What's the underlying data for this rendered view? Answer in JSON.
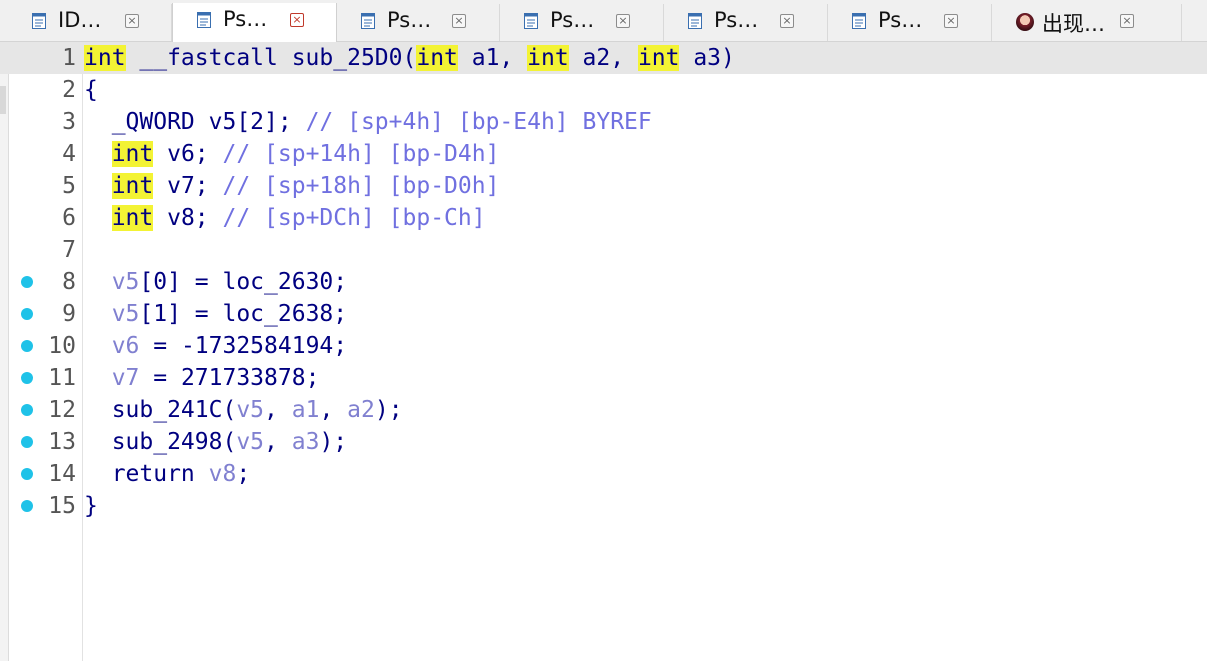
{
  "tabs": [
    {
      "label": "ID…",
      "icon": "document-icon",
      "active": false
    },
    {
      "label": "Ps…",
      "icon": "document-icon",
      "active": true
    },
    {
      "label": "Ps…",
      "icon": "document-icon",
      "active": false
    },
    {
      "label": "Ps…",
      "icon": "document-icon",
      "active": false
    },
    {
      "label": "Ps…",
      "icon": "document-icon",
      "active": false
    },
    {
      "label": "Ps…",
      "icon": "document-icon",
      "active": false
    },
    {
      "label": "出现…",
      "icon": "avatar-icon",
      "active": false
    }
  ],
  "close_glyph": "×",
  "colors": {
    "keyword_highlight": "#f3f334",
    "breakpoint": "#1fc2e8",
    "code_text": "#000080",
    "variable": "#8080d0",
    "comment": "#7070e0",
    "current_line": "#e6e6e6"
  },
  "code": {
    "lines": [
      {
        "num": "1",
        "bp": false,
        "current": true,
        "tokens": [
          {
            "t": "int",
            "c": "kw"
          },
          {
            "t": " __fastcall sub_25D0(",
            "c": "plain"
          },
          {
            "t": "int",
            "c": "kw"
          },
          {
            "t": " a1, ",
            "c": "plain"
          },
          {
            "t": "int",
            "c": "kw"
          },
          {
            "t": " a2, ",
            "c": "plain"
          },
          {
            "t": "int",
            "c": "kw"
          },
          {
            "t": " a3)",
            "c": "plain"
          }
        ]
      },
      {
        "num": "2",
        "bp": false,
        "current": false,
        "tokens": [
          {
            "t": "{",
            "c": "plain"
          }
        ]
      },
      {
        "num": "3",
        "bp": false,
        "current": false,
        "tokens": [
          {
            "t": "  _QWORD v5[2]; ",
            "c": "plain"
          },
          {
            "t": "// [sp+4h] [bp-E4h] BYREF",
            "c": "cm"
          }
        ]
      },
      {
        "num": "4",
        "bp": false,
        "current": false,
        "tokens": [
          {
            "t": "  ",
            "c": "plain"
          },
          {
            "t": "int",
            "c": "kw"
          },
          {
            "t": " v6; ",
            "c": "plain"
          },
          {
            "t": "// [sp+14h] [bp-D4h]",
            "c": "cm"
          }
        ]
      },
      {
        "num": "5",
        "bp": false,
        "current": false,
        "tokens": [
          {
            "t": "  ",
            "c": "plain"
          },
          {
            "t": "int",
            "c": "kw"
          },
          {
            "t": " v7; ",
            "c": "plain"
          },
          {
            "t": "// [sp+18h] [bp-D0h]",
            "c": "cm"
          }
        ]
      },
      {
        "num": "6",
        "bp": false,
        "current": false,
        "tokens": [
          {
            "t": "  ",
            "c": "plain"
          },
          {
            "t": "int",
            "c": "kw"
          },
          {
            "t": " v8; ",
            "c": "plain"
          },
          {
            "t": "// [sp+DCh] [bp-Ch]",
            "c": "cm"
          }
        ]
      },
      {
        "num": "7",
        "bp": false,
        "current": false,
        "tokens": []
      },
      {
        "num": "8",
        "bp": true,
        "current": false,
        "tokens": [
          {
            "t": "  ",
            "c": "plain"
          },
          {
            "t": "v5",
            "c": "var"
          },
          {
            "t": "[0] = loc_2630;",
            "c": "plain"
          }
        ]
      },
      {
        "num": "9",
        "bp": true,
        "current": false,
        "tokens": [
          {
            "t": "  ",
            "c": "plain"
          },
          {
            "t": "v5",
            "c": "var"
          },
          {
            "t": "[1] = loc_2638;",
            "c": "plain"
          }
        ]
      },
      {
        "num": "10",
        "bp": true,
        "current": false,
        "tokens": [
          {
            "t": "  ",
            "c": "plain"
          },
          {
            "t": "v6",
            "c": "var"
          },
          {
            "t": " = -1732584194;",
            "c": "plain"
          }
        ]
      },
      {
        "num": "11",
        "bp": true,
        "current": false,
        "tokens": [
          {
            "t": "  ",
            "c": "plain"
          },
          {
            "t": "v7",
            "c": "var"
          },
          {
            "t": " = 271733878;",
            "c": "plain"
          }
        ]
      },
      {
        "num": "12",
        "bp": true,
        "current": false,
        "tokens": [
          {
            "t": "  sub_241C(",
            "c": "plain"
          },
          {
            "t": "v5",
            "c": "var"
          },
          {
            "t": ", ",
            "c": "plain"
          },
          {
            "t": "a1",
            "c": "var"
          },
          {
            "t": ", ",
            "c": "plain"
          },
          {
            "t": "a2",
            "c": "var"
          },
          {
            "t": ");",
            "c": "plain"
          }
        ]
      },
      {
        "num": "13",
        "bp": true,
        "current": false,
        "tokens": [
          {
            "t": "  sub_2498(",
            "c": "plain"
          },
          {
            "t": "v5",
            "c": "var"
          },
          {
            "t": ", ",
            "c": "plain"
          },
          {
            "t": "a3",
            "c": "var"
          },
          {
            "t": ");",
            "c": "plain"
          }
        ]
      },
      {
        "num": "14",
        "bp": true,
        "current": false,
        "tokens": [
          {
            "t": "  return ",
            "c": "plain"
          },
          {
            "t": "v8",
            "c": "var"
          },
          {
            "t": ";",
            "c": "plain"
          }
        ]
      },
      {
        "num": "15",
        "bp": true,
        "current": false,
        "tokens": [
          {
            "t": "}",
            "c": "plain"
          }
        ]
      }
    ]
  }
}
